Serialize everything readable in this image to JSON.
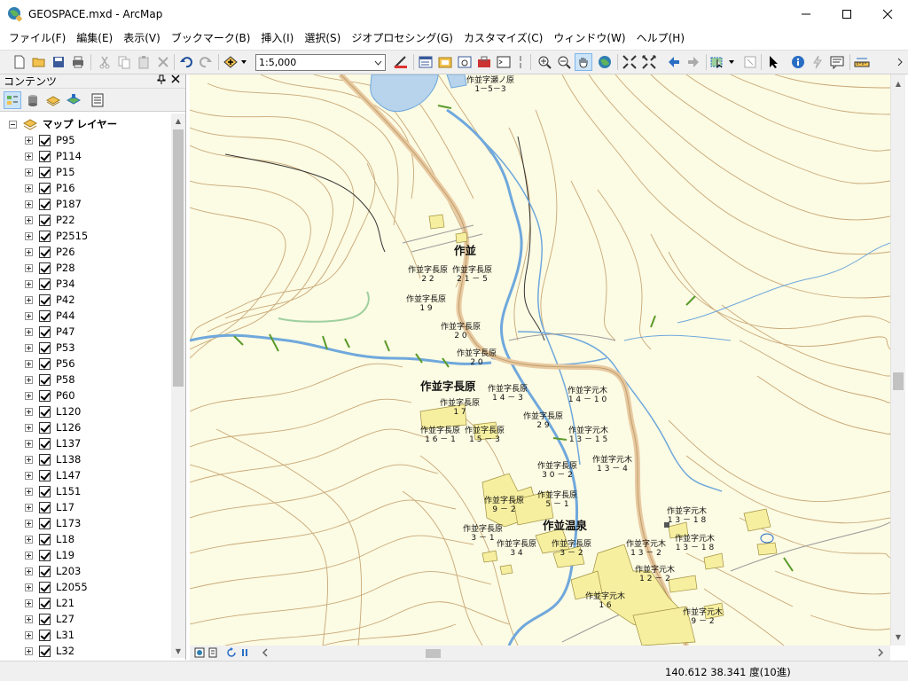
{
  "window": {
    "title": "GEOSPACE.mxd - ArcMap",
    "minimize_label": "—",
    "maximize_label": "☐",
    "close_label": "✕"
  },
  "menu": [
    "ファイル(F)",
    "編集(E)",
    "表示(V)",
    "ブックマーク(B)",
    "挿入(I)",
    "選択(S)",
    "ジオプロセシング(G)",
    "カスタマイズ(C)",
    "ウィンドウ(W)",
    "ヘルプ(H)"
  ],
  "toolbar": {
    "scale_value": "1:5,000"
  },
  "toc": {
    "title": "コンテンツ",
    "pin_label": "ꟷ",
    "close_label": "✕",
    "root_label": "マップ レイヤー",
    "layers": [
      "P95",
      "P114",
      "P15",
      "P16",
      "P187",
      "P22",
      "P2515",
      "P26",
      "P28",
      "P34",
      "P42",
      "P44",
      "P47",
      "P53",
      "P56",
      "P58",
      "P60",
      "L120",
      "L126",
      "L137",
      "L138",
      "L147",
      "L151",
      "L17",
      "L173",
      "L18",
      "L19",
      "L203",
      "L2055",
      "L21",
      "L27",
      "L31",
      "L32"
    ]
  },
  "map": {
    "labels": [
      {
        "text": "作並字瀬ノ原\n1－5－3",
        "big": false
      },
      {
        "text": "作並",
        "big": true
      },
      {
        "text": "作並字長原\n2 2",
        "big": false
      },
      {
        "text": "作並字長原\n2 1 － 5",
        "big": false
      },
      {
        "text": "作並字長原\n1 9",
        "big": false
      },
      {
        "text": "作並字長原\n2 0",
        "big": false
      },
      {
        "text": "作並字長原\n2 0",
        "big": false
      },
      {
        "text": "作並字長原",
        "big": true
      },
      {
        "text": "作並字長原\n1 4 － 3",
        "big": false
      },
      {
        "text": "作並字元木\n1 4 － 1 0",
        "big": false
      },
      {
        "text": "作並字長原\n1 7",
        "big": false
      },
      {
        "text": "作並字長原\n2 9",
        "big": false
      },
      {
        "text": "作並字長原\n1 6 － 1",
        "big": false
      },
      {
        "text": "作並字長原\n1 5 － 3",
        "big": false
      },
      {
        "text": "作並字元木\n1 3 － 1 5",
        "big": false
      },
      {
        "text": "作並字長原\n3 0 － 2",
        "big": false
      },
      {
        "text": "作並字元木\n1 3 － 4",
        "big": false
      },
      {
        "text": "作並字長原\n5 － 1",
        "big": false
      },
      {
        "text": "作並字長原\n9 － 2",
        "big": false
      },
      {
        "text": "作並温泉",
        "big": true
      },
      {
        "text": "作並字元木\n1 3 － 1 8",
        "big": false
      },
      {
        "text": "作並字長原\n3 － 1",
        "big": false
      },
      {
        "text": "作並字長原\n3 4",
        "big": false
      },
      {
        "text": "作並字長原\n3 － 2",
        "big": false
      },
      {
        "text": "作並字元木\n1 3 － 2",
        "big": false
      },
      {
        "text": "作並字元木\n1 3 － 1 8",
        "big": false
      },
      {
        "text": "作並字元木\n1 2 － 2",
        "big": false
      },
      {
        "text": "作並字元木\n1 6",
        "big": false
      },
      {
        "text": "作並字元木\n9 － 2",
        "big": false
      }
    ]
  },
  "status": {
    "coordinates": "140.612  38.341 度(10進)"
  },
  "colors": {
    "map_background": "#fcfbe3",
    "contour": "#c8a878",
    "river": "#6fa8dc",
    "road": "#e8c9a0",
    "building": "#f6efa0"
  }
}
